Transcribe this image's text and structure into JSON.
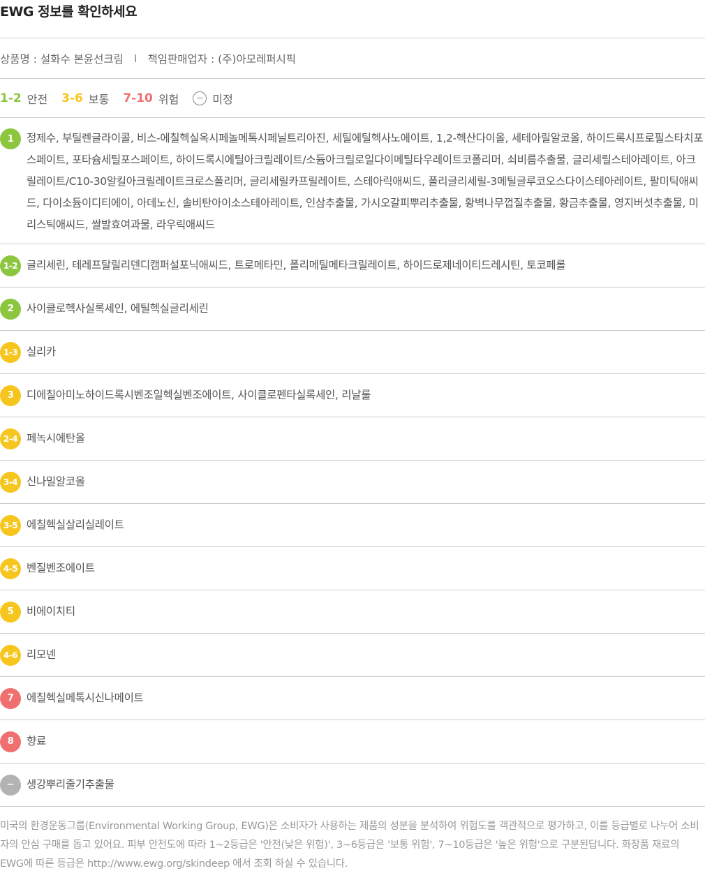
{
  "title": "EWG 정보를 확인하세요",
  "product": {
    "name": "상품명 : 설화수 본윤선크림",
    "separator": "I",
    "seller": "책임판매업자 : (주)아모레퍼시픽"
  },
  "legend": [
    {
      "range": "1-2",
      "label": "안전",
      "color": "#8cc63f"
    },
    {
      "range": "3-6",
      "label": "보통",
      "color": "#f6c61e"
    },
    {
      "range": "7-10",
      "label": "위험",
      "color": "#f07070"
    },
    {
      "range": "",
      "label": "미정",
      "color": "#888888",
      "icon": "minus-circle-icon"
    }
  ],
  "colors": {
    "safe": "#8cc63f",
    "moderate": "#f6c61e",
    "danger": "#f07070",
    "unknown": "#b3b3b3"
  },
  "ingredients": [
    {
      "grade": "1",
      "level": "safe",
      "text": "정제수, 부틸렌글라이콜, 비스-에칠헥실옥시페놀메톡시페닐트리아진, 세틸에틸헥사노에이트, 1,2-헥산다이올, 세테아릴알코올, 하이드록시프로필스타치포스페이트, 포타슘세틸포스페이트, 하이드록시에틸아크릴레이트/소듐아크릴로일다이메틸타우레이트코폴리머, 쇠비름추출물, 글리세릴스테아레이트, 아크릴레이트/C10-30알킬아크릴레이트크로스폴리머, 글리세릴카프릴레이트, 스테아릭애씨드, 폴리글리세릴-3메틸글루코오스다이스테아레이트, 팔미틱애씨드, 다이소듐이디티에이, 아데노신, 솔비탄아이소스테아레이트, 인삼추출물, 가시오갈피뿌리추출물, 황벽나무껍질추출물, 황금추출물, 영지버섯추출물, 미리스틱애씨드, 쌀발효여과물, 라우릭애씨드"
    },
    {
      "grade": "1-2",
      "level": "safe",
      "text": "글리세린, 테레프탈릴리덴디캠퍼설포닉애씨드, 트로메타민, 폴리메틸메타크릴레이트, 하이드로제네이티드레시틴, 토코페롤"
    },
    {
      "grade": "2",
      "level": "safe",
      "text": "사이클로헥사실록세인, 에틸헥실글리세린"
    },
    {
      "grade": "1-3",
      "level": "moderate",
      "text": "실리카"
    },
    {
      "grade": "3",
      "level": "moderate",
      "text": "디에칠아미노하이드록시벤조일헥실벤조에이트, 사이클로펜타실록세인, 리날룰"
    },
    {
      "grade": "2-4",
      "level": "moderate",
      "text": "페녹시에탄올"
    },
    {
      "grade": "3-4",
      "level": "moderate",
      "text": "신나밀알코올"
    },
    {
      "grade": "3-5",
      "level": "moderate",
      "text": "에칠헥실살리실레이트"
    },
    {
      "grade": "4-5",
      "level": "moderate",
      "text": "벤질벤조에이트"
    },
    {
      "grade": "5",
      "level": "moderate",
      "text": "비에이치티"
    },
    {
      "grade": "4-6",
      "level": "moderate",
      "text": "리모넨"
    },
    {
      "grade": "7",
      "level": "danger",
      "text": "에칠헥실메톡시신나메이트"
    },
    {
      "grade": "8",
      "level": "danger",
      "text": "향료"
    },
    {
      "grade": "−",
      "level": "unknown",
      "text": "생강뿌리줄기추출물"
    }
  ],
  "footer": "미국의 환경운동그룹(Environmental Working Group, EWG)은 소비자가 사용하는 제품의 성분을 분석하여 위험도를 객관적으로 평가하고, 이를 등급별로 나누어 소비자의 안심 구매를 돕고 있어요. 피부 안전도에 따라 1~2등급은 '안전(낮은 위험)', 3~6등급은 '보통 위험', 7~10등급은 '높은 위험'으로 구분된답니다. 화장품 재료의 EWG에 따른 등급은 http://www.ewg.org/skindeep 에서 조회 하실 수 있습니다."
}
